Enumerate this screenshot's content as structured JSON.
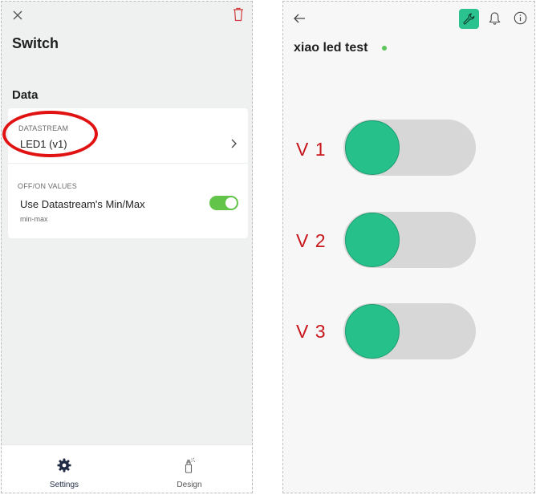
{
  "left_screen": {
    "title": "Switch",
    "section": "Data",
    "datastream": {
      "caption": "DATASTREAM",
      "value": "LED1 (v1)"
    },
    "values": {
      "caption": "OFF/ON VALUES",
      "label": "Use Datastream's Min/Max",
      "sub": "min-max",
      "toggle_on": true
    },
    "tabs": [
      {
        "label": "Settings",
        "icon": "gear-icon",
        "active": true
      },
      {
        "label": "Design",
        "icon": "spray-can-icon",
        "active": false
      }
    ]
  },
  "right_screen": {
    "device_name": "xiao led test",
    "status_color": "#5cc55a",
    "switches": [
      {
        "label": "V 1",
        "state": "off"
      },
      {
        "label": "V 2",
        "state": "off"
      },
      {
        "label": "V 3",
        "state": "off"
      }
    ]
  },
  "colors": {
    "accent_green": "#2ac28f",
    "toggle_green": "#63c44a",
    "annotation_red": "#e01212",
    "label_red": "#c8171c"
  }
}
